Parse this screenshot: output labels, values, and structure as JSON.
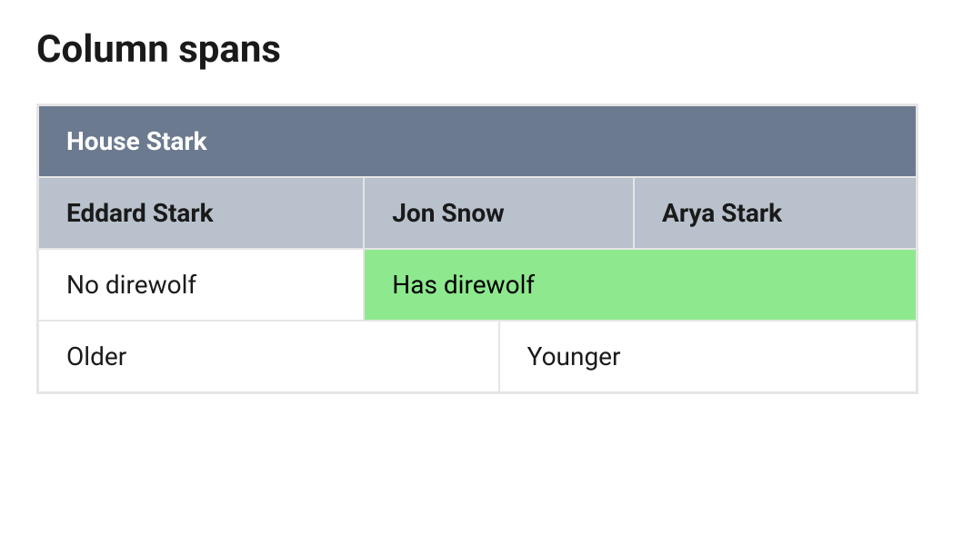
{
  "title": "Column spans",
  "table": {
    "header_top": "House Stark",
    "header_sub": [
      "Eddard Stark",
      "Jon Snow",
      "Arya Stark"
    ],
    "row1": {
      "cell1": "No direwolf",
      "cell2": "Has direwolf"
    },
    "row2": {
      "cell1": "Older",
      "cell2": "Younger"
    }
  }
}
